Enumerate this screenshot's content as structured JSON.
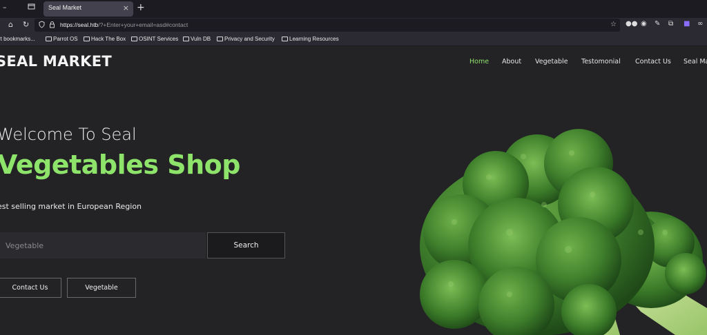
{
  "browser": {
    "tab_title": "Seal Market",
    "url_host": "https://seal.htb",
    "url_rest": "/?+Enter+your+email=asd#contact",
    "bookmarks": [
      "rt bookmarks...",
      "Parrot OS",
      "Hack The Box",
      "OSINT Services",
      "Vuln DB",
      "Privacy and Security",
      "Learning Resources"
    ]
  },
  "site": {
    "brand": "SEAL MARKET",
    "menu": [
      "Home",
      "About",
      "Vegetable",
      "Testomonial",
      "Contact Us",
      "Seal Ma"
    ],
    "welcome": "Welcome To Seal",
    "headline": "Vegetables Shop",
    "tagline": "est selling market in European Region",
    "search_placeholder": "Vegetable",
    "search_button": "Search",
    "buttons": [
      "Contact Us",
      "Vegetable"
    ]
  },
  "colors": {
    "accent_green": "#8ee36b",
    "background": "#232326"
  }
}
